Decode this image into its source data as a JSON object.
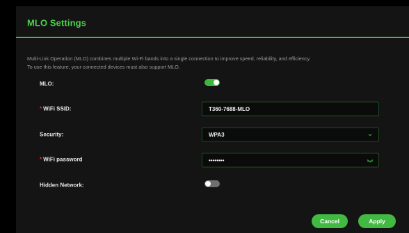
{
  "panel": {
    "title": "MLO Settings",
    "description_line1": "Multi-Link Operation (MLO) combines multiple Wi-Fi bands into a single connection to improve speed, reliability, and efficiency.",
    "description_line2": "To use this feature, your connected devices must also support MLO."
  },
  "form": {
    "mlo": {
      "label": "MLO:",
      "enabled": true
    },
    "ssid": {
      "label": "WiFi SSID:",
      "required_mark": "*",
      "value": "T360-7688-MLO"
    },
    "security": {
      "label": "Security:",
      "value": "WPA3",
      "icon": "chevron-down-icon"
    },
    "password": {
      "label": "WiFi password",
      "required_mark": "*",
      "value": "••••••••",
      "icon": "eye-closed-icon"
    },
    "hidden_network": {
      "label": "Hidden Network:",
      "enabled": false
    }
  },
  "buttons": {
    "cancel": "Cancel",
    "apply": "Apply"
  },
  "colors": {
    "accent": "#42b942",
    "title": "#4ad34a",
    "required": "#e03b3b",
    "panel_bg": "#141414"
  }
}
